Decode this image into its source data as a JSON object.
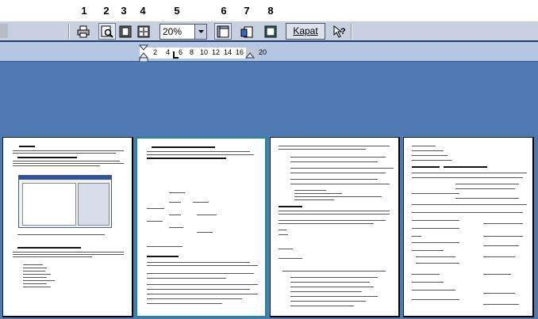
{
  "callouts": [
    "1",
    "2",
    "3",
    "4",
    "5",
    "6",
    "7",
    "8"
  ],
  "toolbar": {
    "zoom_value": "20%",
    "close_label": "Kapat",
    "buttons": [
      "print-icon",
      "magnifier-icon",
      "one-page-icon",
      "multiple-pages-icon",
      "view-ruler-icon",
      "shrink-to-fit-icon",
      "full-screen-icon",
      "context-help-icon"
    ]
  },
  "ruler": {
    "ticks": [
      "2",
      "4",
      "6",
      "8",
      "10",
      "12",
      "14",
      "16",
      "20"
    ]
  },
  "pages": [
    {
      "label": "page-1",
      "selected": false
    },
    {
      "label": "page-2",
      "selected": true
    },
    {
      "label": "page-3",
      "selected": false
    },
    {
      "label": "page-4",
      "selected": false
    }
  ],
  "colors": {
    "workspace": "#4f79b3",
    "toolbar": "#c8d0e0",
    "selected_page_border": "#1a8c8c"
  }
}
